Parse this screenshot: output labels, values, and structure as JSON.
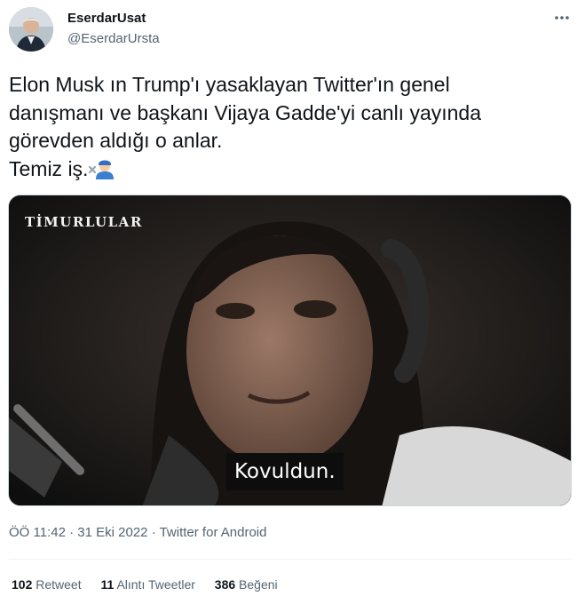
{
  "author": {
    "display_name": "EserdarUsat",
    "handle": "@EserdarUrsta"
  },
  "more_icon": "more-dots-icon",
  "tweet": {
    "lines": [
      "Elon Musk ın Trump'ı yasaklayan Twitter'ın genel",
      "danışmanı ve başkanı Vijaya Gadde'yi canlı yayında",
      "görevden aldığı o anlar.",
      "Temiz iş."
    ],
    "emoji": "mechanic-emoji"
  },
  "video": {
    "watermark": "TİMURLULAR",
    "subtitle": "Kovuldun."
  },
  "meta": {
    "time": "ÖÖ 11:42",
    "date": "31 Eki 2022",
    "separator": "·",
    "source": "Twitter for Android"
  },
  "stats": {
    "retweets_count": "102",
    "retweets_label": "Retweet",
    "quotes_count": "11",
    "quotes_label": "Alıntı Tweetler",
    "likes_count": "386",
    "likes_label": "Beğeni"
  },
  "colors": {
    "text_primary": "#0f1419",
    "text_secondary": "#536471",
    "divider": "#eff3f4"
  }
}
